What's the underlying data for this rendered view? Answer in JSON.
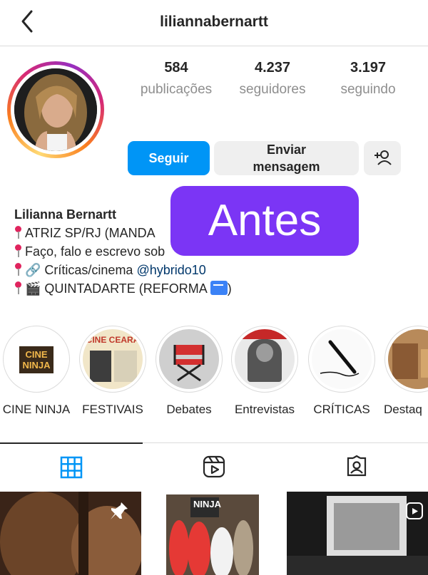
{
  "header": {
    "username": "liliannabernartt",
    "back_icon": "chevron-left-icon"
  },
  "stats": [
    {
      "value": "584",
      "label": "publicações"
    },
    {
      "value": "4.237",
      "label": "seguidores"
    },
    {
      "value": "3.197",
      "label": "seguindo"
    }
  ],
  "actions": {
    "follow": "Seguir",
    "message": "Enviar mensagem",
    "add_icon": "add-person-icon"
  },
  "bio": {
    "name": "Lilianna Bernartt",
    "line1": "ATRIZ SP/RJ (MANDA",
    "line2": "Faço, falo e escrevo sob",
    "line3_prefix": "🔗 Críticas/cinema ",
    "line3_mention": "@hybrido10",
    "line4": "🎬 QUINTADARTE (REFORMA ",
    "line4_end": ")"
  },
  "overlay": {
    "text": "Antes",
    "color": "#7b35f5"
  },
  "highlights": [
    {
      "label": "CINE NINJA",
      "icon_text": "CINE\nNINJA"
    },
    {
      "label": "FESTIVAIS",
      "icon_text": "CINE CEARÁ"
    },
    {
      "label": "Debates"
    },
    {
      "label": "Entrevistas"
    },
    {
      "label": "CRÍTICAS"
    },
    {
      "label": "Destaq"
    }
  ],
  "tabs": [
    {
      "name": "posts",
      "icon": "grid-icon",
      "active": true
    },
    {
      "name": "reels",
      "icon": "reels-icon",
      "active": false
    },
    {
      "name": "tagged",
      "icon": "tagged-icon",
      "active": false
    }
  ],
  "posts": [
    {
      "pinned": true,
      "icon": "pin-icon"
    },
    {
      "sign_text": "NINJA"
    },
    {
      "reel": true,
      "icon": "reel-icon"
    }
  ],
  "colors": {
    "accent": "#0095f6",
    "muted": "#8e8e8e",
    "button_bg": "#efefef",
    "mention": "#00376b"
  }
}
